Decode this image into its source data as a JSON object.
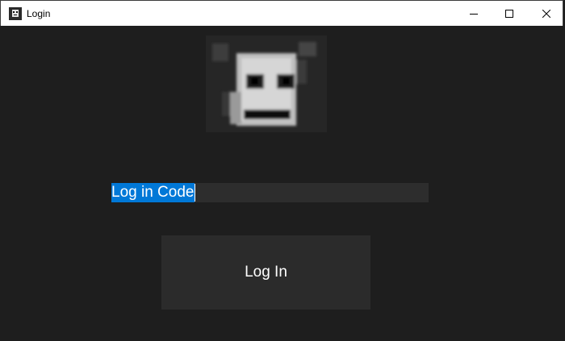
{
  "window": {
    "title": "Login",
    "icon": "robot-face-icon",
    "controls": [
      "minimize-icon",
      "maximize-icon",
      "close-icon"
    ]
  },
  "logo": {
    "icon": "robot-face-logo"
  },
  "login_code": {
    "value": "Log in Code",
    "selected": true
  },
  "login_button": {
    "label": "Log In"
  },
  "colors": {
    "background": "#1e1e1e",
    "titlebar": "#ffffff",
    "field": "#2d2d2d",
    "selection": "#0078d7",
    "button": "#2b2b2b",
    "text": "#ffffff"
  }
}
